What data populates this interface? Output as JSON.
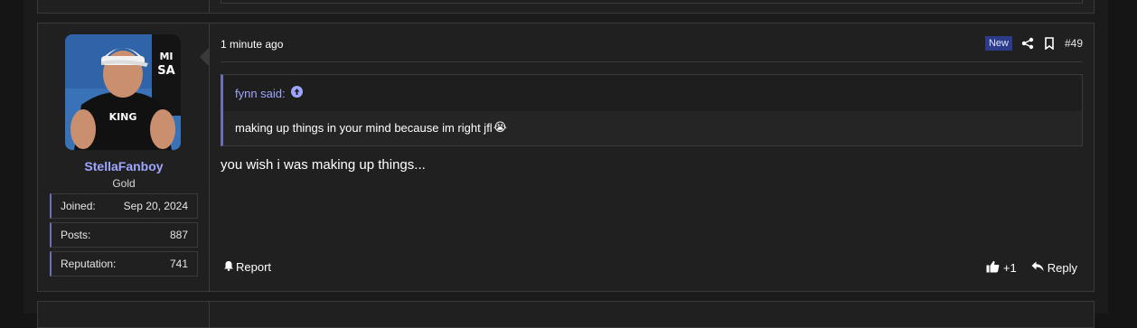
{
  "post": {
    "timestamp": "1 minute ago",
    "badge": "New",
    "number": "#49",
    "icons": {
      "share": "share-icon",
      "bookmark": "bookmark-icon"
    },
    "message": "you wish i was making up things...",
    "actions": {
      "report": "Report",
      "like_count": "+1",
      "reply": "Reply"
    }
  },
  "user": {
    "name": "StellaFanboy",
    "title": "Gold",
    "stats": [
      {
        "label": "Joined:",
        "value": "Sep 20, 2024"
      },
      {
        "label": "Posts:",
        "value": "887"
      },
      {
        "label": "Reputation:",
        "value": "741"
      }
    ],
    "avatar_caption_text": "KING"
  },
  "quote": {
    "author": "fynn said:",
    "text": "making up things in your mind because im right jfl",
    "emoji": "😭"
  },
  "colors": {
    "background": "#151515",
    "card": "#202020",
    "border": "#3a3a3a",
    "accent": "#9ea7ff",
    "badge": "#2d3c8a"
  }
}
